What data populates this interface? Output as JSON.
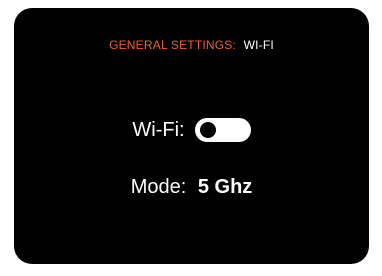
{
  "header": {
    "section": "GENERAL SETTINGS:",
    "page": "WI-FI",
    "section_color": "#e8622c"
  },
  "wifi": {
    "label": "Wi-Fi:",
    "enabled": false
  },
  "mode": {
    "label": "Mode:",
    "value": "5 Ghz"
  }
}
